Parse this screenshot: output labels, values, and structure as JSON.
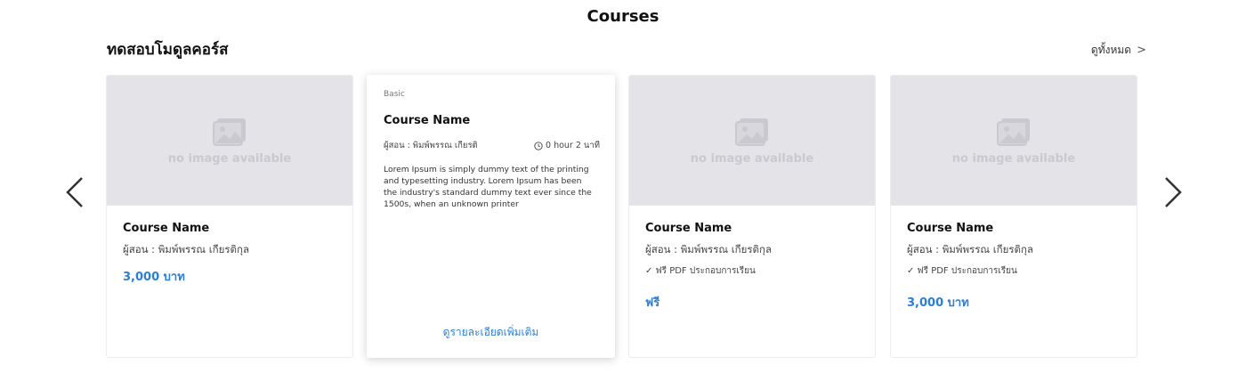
{
  "header": {
    "title": "Courses"
  },
  "section": {
    "title": "ทดสอบโมดูลคอร์ส",
    "view_all": "ดูทั้งหมด",
    "view_all_chevron": ">"
  },
  "placeholder_text": "no image available",
  "cards": [
    {
      "name": "Course Name",
      "instructor": "ผู้สอน : พิมพ์พรรณ เกียรติกุล",
      "price": "3,000 บาท"
    },
    {
      "level": "Basic",
      "name": "Course Name",
      "instructor": "ผู้สอน : พิมพ์พรรณ เกียรติ",
      "duration": "0 hour 2 นาที",
      "description": "Lorem Ipsum is simply dummy text of the printing and typesetting industry. Lorem Ipsum has been the industry's standard dummy text ever since the 1500s, when an unknown printer",
      "more": "ดูรายละเอียดเพิ่มเติม"
    },
    {
      "name": "Course Name",
      "instructor": "ผู้สอน : พิมพ์พรรณ เกียรติกุล",
      "feature": "✓ ฟรี PDF ประกอบการเรียน",
      "price": "ฟรี"
    },
    {
      "name": "Course Name",
      "instructor": "ผู้สอน : พิมพ์พรรณ เกียรติกุล",
      "feature": "✓ ฟรี PDF ประกอบการเรียน",
      "price": "3,000 บาท"
    }
  ],
  "colors": {
    "accent": "#2b7fd4",
    "placeholder_bg": "#e4e4e8",
    "placeholder_fg": "#c9c9cf"
  },
  "icons": {
    "prev": "chevron-left-icon",
    "next": "chevron-right-icon",
    "image": "image-icon",
    "clock": "clock-icon"
  }
}
